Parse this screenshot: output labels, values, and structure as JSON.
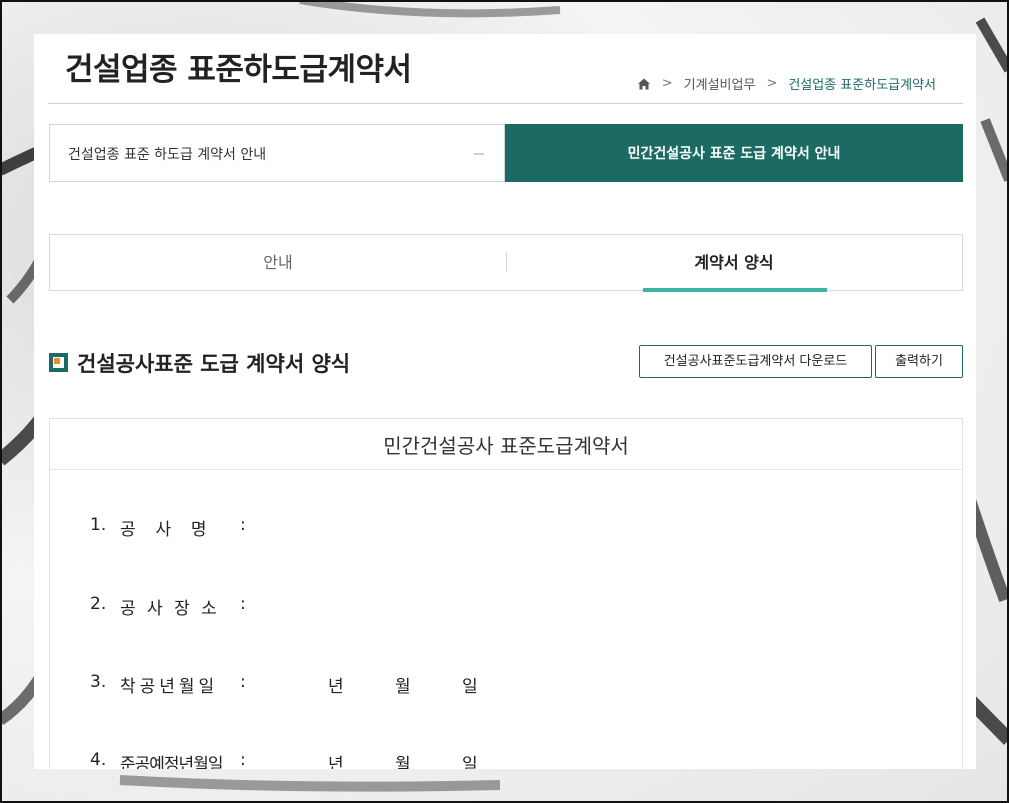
{
  "page": {
    "title": "건설업종 표준하도급계약서"
  },
  "breadcrumb": {
    "icon": "home-icon",
    "items": [
      "기계설비업무",
      "건설업종 표준하도급계약서"
    ]
  },
  "top_tabs": {
    "left_label": "건설업종 표준 하도급 계약서 안내",
    "right_label": "민간건설공사 표준 도급 계약서 안내",
    "active_color": "#1b6a63"
  },
  "sub_tabs": {
    "items": [
      "안내",
      "계약서 양식"
    ],
    "active_index": 1,
    "underline_color": "#3bb3a7"
  },
  "section": {
    "title": "건설공사표준 도급 계약서 양식",
    "download_button": "건설공사표준도급계약서 다운로드",
    "print_button": "출력하기"
  },
  "document": {
    "title": "민간건설공사 표준도급계약서",
    "rows": [
      {
        "num": "1.",
        "label": "공  사  명",
        "colon": ":",
        "year": "",
        "month": "",
        "day": ""
      },
      {
        "num": "2.",
        "label": "공 사 장 소",
        "colon": ":",
        "year": "",
        "month": "",
        "day": ""
      },
      {
        "num": "3.",
        "label": "착공년월일",
        "colon": ":",
        "year": "년",
        "month": "월",
        "day": "일"
      },
      {
        "num": "4.",
        "label": "준공예정년월일",
        "colon": ":",
        "year": "년",
        "month": "월",
        "day": "일"
      }
    ]
  }
}
